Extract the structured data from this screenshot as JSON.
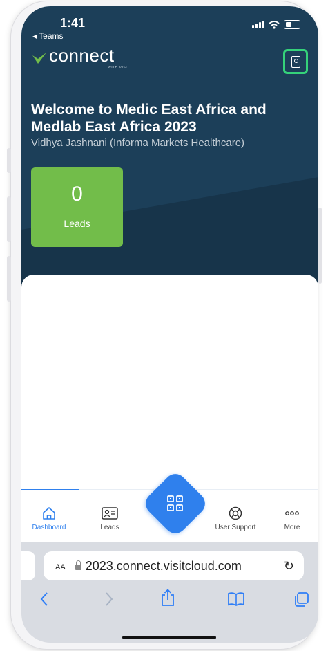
{
  "status_bar": {
    "time": "1:41",
    "back_label": "◂ Teams"
  },
  "header": {
    "logo_text": "connect",
    "logo_sub": "WITH VISIT",
    "badge_icon": "badge-icon"
  },
  "welcome": {
    "title": "Welcome to Medic East Africa and Medlab East Africa 2023",
    "subtitle": "Vidhya Jashnani (Informa Markets Healthcare)"
  },
  "leads_card": {
    "count": "0",
    "label": "Leads"
  },
  "nav": {
    "items": [
      {
        "label": "Dashboard",
        "icon": "home-icon",
        "active": true
      },
      {
        "label": "Leads",
        "icon": "contact-card-icon",
        "active": false
      },
      {
        "label": "User Support",
        "icon": "lifebuoy-icon",
        "active": false
      },
      {
        "label": "More",
        "icon": "more-dots-icon",
        "active": false
      }
    ],
    "scan_icon": "qr-scan-icon"
  },
  "browser": {
    "aa_label": "AA",
    "url": "2023.connect.visitcloud.com",
    "tools": [
      "back-icon",
      "forward-icon",
      "share-icon",
      "bookmarks-icon",
      "tabs-icon"
    ]
  },
  "colors": {
    "header_bg": "#1c3f59",
    "leads_green": "#72bd4a",
    "accent_blue": "#2f80ed",
    "highlight_green": "#35d27a"
  }
}
